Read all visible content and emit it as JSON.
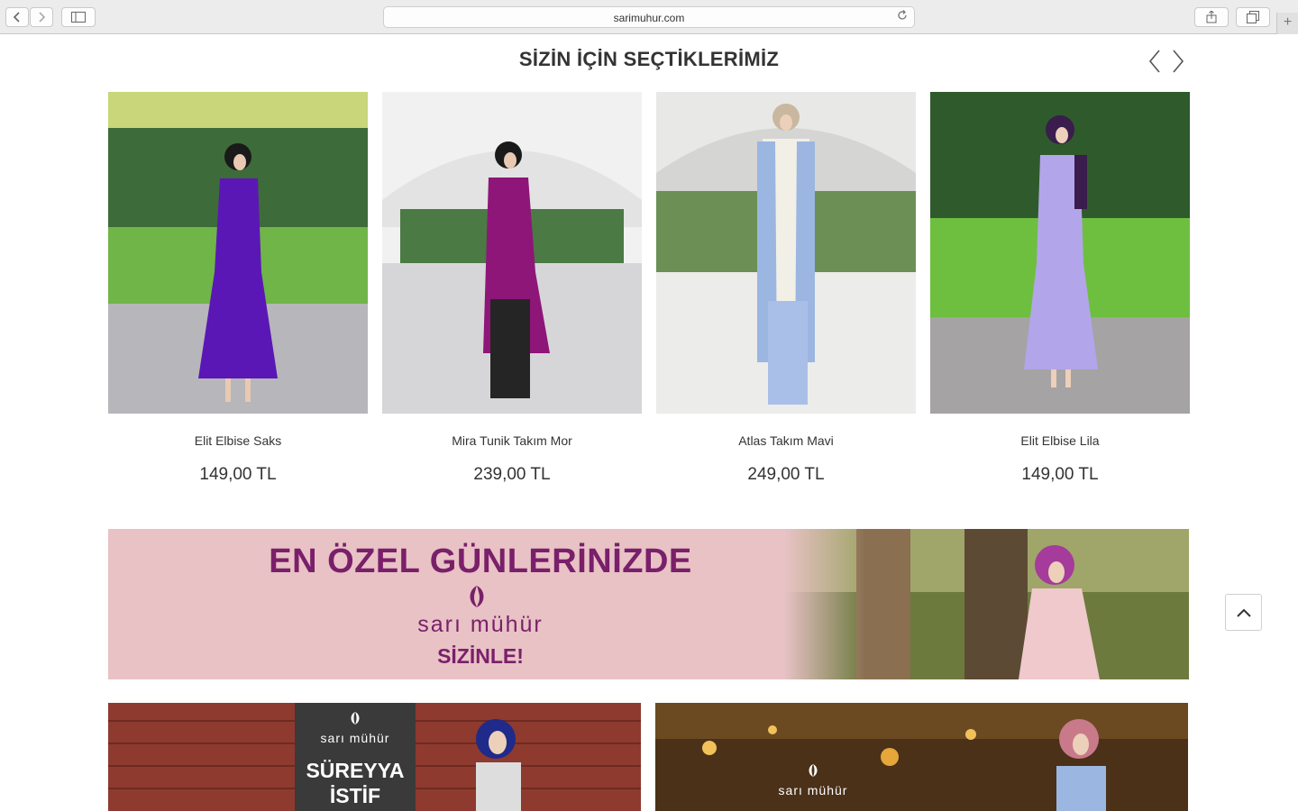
{
  "browser": {
    "url": "sarimuhur.com"
  },
  "section": {
    "title": "SİZİN İÇİN SEÇTİKLERİMİZ"
  },
  "products": [
    {
      "name": "Elit Elbise Saks",
      "price": "149,00 TL",
      "color": "#5b17b5"
    },
    {
      "name": "Mira Tunik Takım Mor",
      "price": "239,00 TL",
      "color": "#8e1678"
    },
    {
      "name": "Atlas Takım Mavi",
      "price": "249,00 TL",
      "color": "#9cb6e2"
    },
    {
      "name": "Elit Elbise Lila",
      "price": "149,00 TL",
      "color": "#b3a5ea"
    }
  ],
  "banner": {
    "headline": "EN ÖZEL GÜNLERİNİZDE",
    "brand": "sarı mühür",
    "tagline": "SİZİNLE!",
    "bg_color": "#e8c2c5",
    "text_color": "#7a1f6a"
  },
  "bottom_banners": [
    {
      "brand": "sarı mühür",
      "title_line1": "SÜREYYA",
      "title_line2": "İSTİF"
    },
    {
      "brand": "sarı mühür"
    }
  ]
}
